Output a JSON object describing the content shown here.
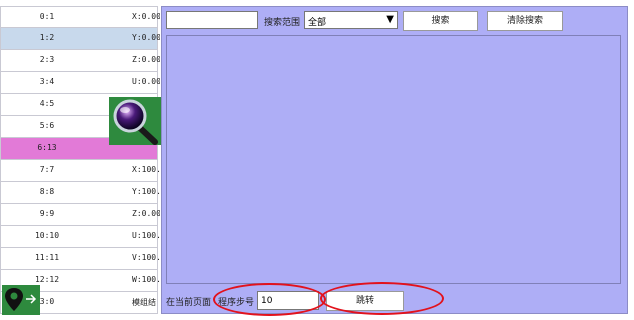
{
  "steps": [
    {
      "idx": "0:1",
      "cmd": "X:0.00"
    },
    {
      "idx": "1:2",
      "cmd": "Y:0.00",
      "selected": true
    },
    {
      "idx": "2:3",
      "cmd": "Z:0.00"
    },
    {
      "idx": "3:4",
      "cmd": "U:0.00"
    },
    {
      "idx": "4:5",
      "cmd": ""
    },
    {
      "idx": "5:6",
      "cmd": ""
    },
    {
      "idx": "6:13",
      "cmd": "",
      "highlight": true
    },
    {
      "idx": "7:7",
      "cmd": "X:100."
    },
    {
      "idx": "8:8",
      "cmd": "Y:100."
    },
    {
      "idx": "9:9",
      "cmd": "Z:0.00"
    },
    {
      "idx": "10:10",
      "cmd": "U:100."
    },
    {
      "idx": "11:11",
      "cmd": "V:100."
    },
    {
      "idx": "12:12",
      "cmd": "W:100."
    },
    {
      "idx": "3:0",
      "cmd": "模组结"
    }
  ],
  "search": {
    "input_value": "",
    "scope_label": "搜索范围",
    "scope_value": "全部",
    "search_button": "搜索",
    "clear_button": "清除搜索"
  },
  "footer": {
    "page_label": "在当前页面",
    "step_label": "程序步号",
    "step_value": "10",
    "jump_button": "跳转"
  },
  "colors": {
    "panel_bg": "#aeaef6",
    "selected_row": "#c8d9ec",
    "highlight_row": "#e27ad7",
    "overlay_green": "#2e8a3e",
    "annotation_red": "#e2121c"
  },
  "icons": {
    "magnifier": "magnifier-icon",
    "location_pin": "location-pin-icon"
  }
}
